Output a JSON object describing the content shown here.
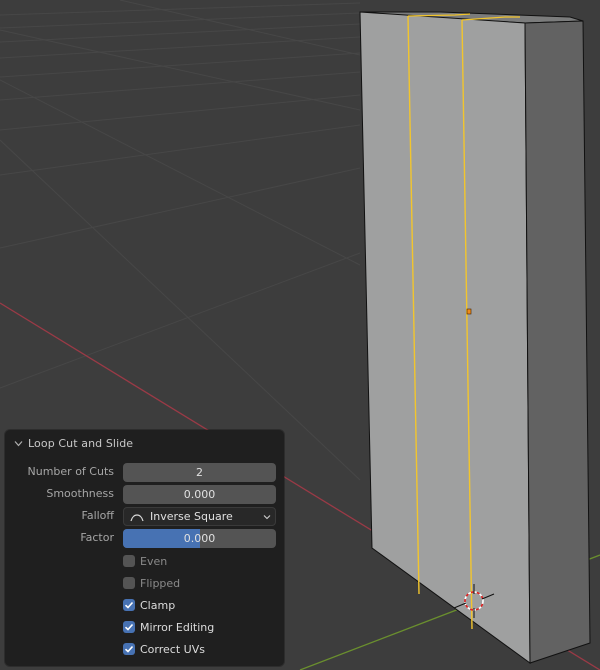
{
  "app": "Blender 3D Viewport - Edit Mode",
  "colors": {
    "viewport_bg": "#3d3d3d",
    "grid": "#4a4a4a",
    "x_axis": "#9a3a46",
    "y_axis": "#6a8f2e",
    "mesh_front": "#9fa0a0",
    "mesh_side": "#626262",
    "mesh_top": "#7b7c7c",
    "loop_cut": "#f2c52d",
    "accent": "#4772b3",
    "panel_bg": "#1f1f1f"
  },
  "operator_panel": {
    "title": "Loop Cut and Slide",
    "collapse_icon": "chevron-down-icon",
    "fields": {
      "number_of_cuts": {
        "label": "Number of Cuts",
        "value": "2"
      },
      "smoothness": {
        "label": "Smoothness",
        "value": "0.000"
      },
      "falloff": {
        "label": "Falloff",
        "value": "Inverse Square",
        "icon": "falloff-curve-icon"
      },
      "factor": {
        "label": "Factor",
        "value": "0.000",
        "fill_fraction": 0.5
      }
    },
    "checkboxes": [
      {
        "label": "Even",
        "checked": false,
        "enabled": false
      },
      {
        "label": "Flipped",
        "checked": false,
        "enabled": false
      },
      {
        "label": "Clamp",
        "checked": true,
        "enabled": true
      },
      {
        "label": "Mirror Editing",
        "checked": true,
        "enabled": true
      },
      {
        "label": "Correct UVs",
        "checked": true,
        "enabled": true
      }
    ]
  },
  "scene": {
    "object": "box mesh",
    "loop_cuts": 2,
    "cursor_icon": "3d-cursor-icon",
    "origin_icon": "object-origin-icon"
  }
}
